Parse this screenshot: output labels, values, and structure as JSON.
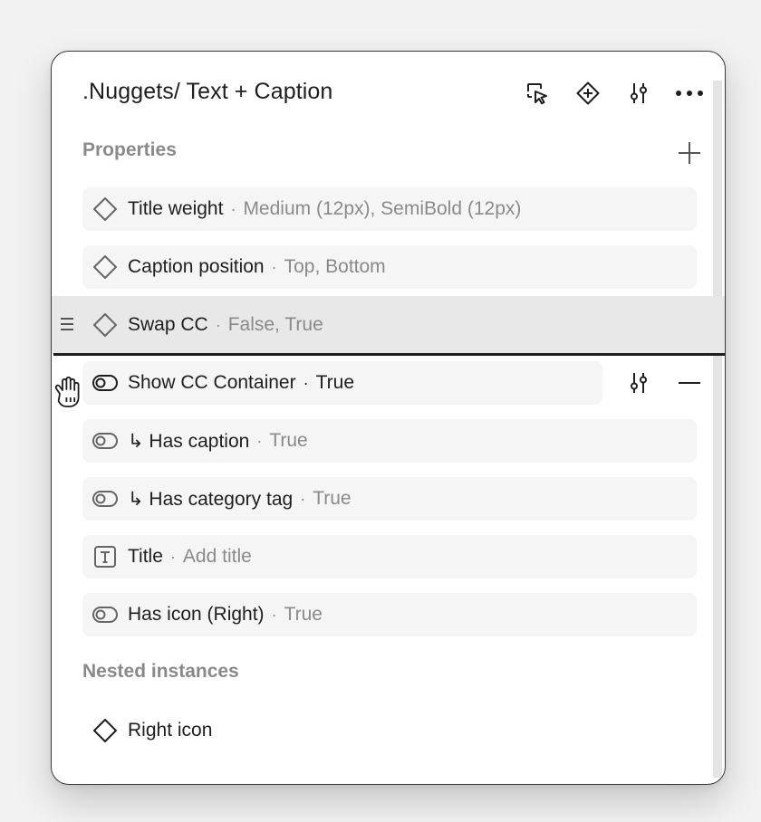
{
  "header": {
    "title": ".Nuggets/ Text + Caption",
    "icons": [
      "select-instances-icon",
      "component-plus-icon",
      "adjust-sliders-icon",
      "more-icon"
    ]
  },
  "properties": {
    "label": "Properties",
    "items": [
      {
        "icon": "variant-diamond-icon",
        "name": "Title weight",
        "separator": "·",
        "value": "Medium (12px), SemiBold (12px)"
      },
      {
        "icon": "variant-diamond-icon",
        "name": "Caption position",
        "separator": "·",
        "value": "Top, Bottom"
      },
      {
        "icon": "variant-diamond-icon",
        "name": "Swap CC",
        "separator": "·",
        "value": "False, True"
      },
      {
        "icon": "toggle-icon",
        "name": "Show CC Container",
        "separator": "·",
        "value": "True"
      },
      {
        "icon": "toggle-icon",
        "name": "↳ Has caption",
        "separator": "·",
        "value": "True"
      },
      {
        "icon": "toggle-icon",
        "name": "↳ Has category tag",
        "separator": "·",
        "value": "True"
      },
      {
        "icon": "text-icon",
        "name": "Title",
        "separator": "·",
        "value": "Add title"
      },
      {
        "icon": "toggle-icon",
        "name": "Has icon (Right)",
        "separator": "·",
        "value": "True"
      }
    ]
  },
  "nested": {
    "label": "Nested instances",
    "items": [
      {
        "icon": "instance-diamond-icon",
        "name": "Right icon"
      }
    ]
  },
  "colors": {
    "panel_bg": "#ffffff",
    "row_bg": "#f5f5f5",
    "drag_bg": "#e8e8e8",
    "text_primary": "#1e1e1e",
    "text_secondary": "#8a8a8a"
  }
}
